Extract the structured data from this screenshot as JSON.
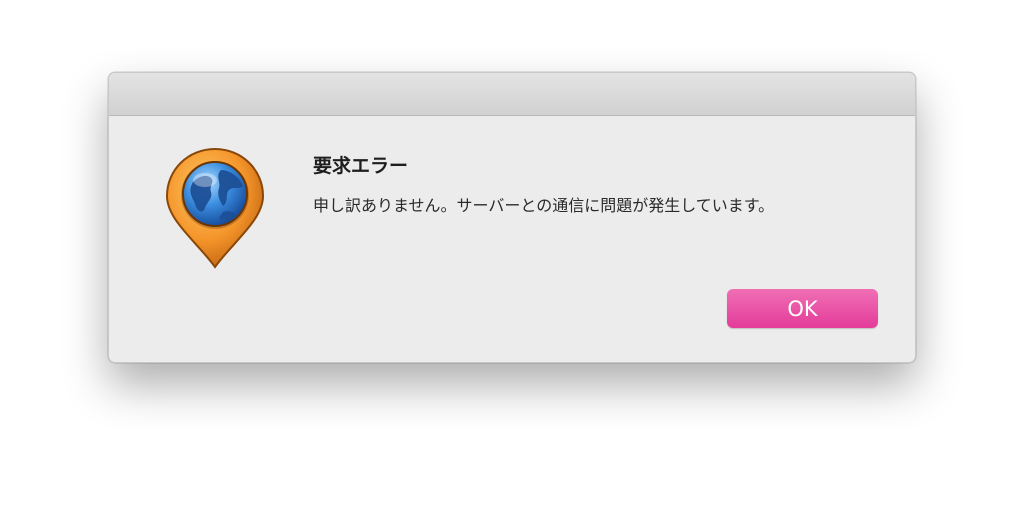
{
  "dialog": {
    "title": "要求エラー",
    "message": "申し訳ありません。サーバーとの通信に問題が発生しています。",
    "ok_label": "OK",
    "icon": "globe-map-pin-icon"
  },
  "colors": {
    "ok_button": "#e64aa3",
    "dialog_background": "#ececec",
    "titlebar": "#d9d9d9"
  }
}
